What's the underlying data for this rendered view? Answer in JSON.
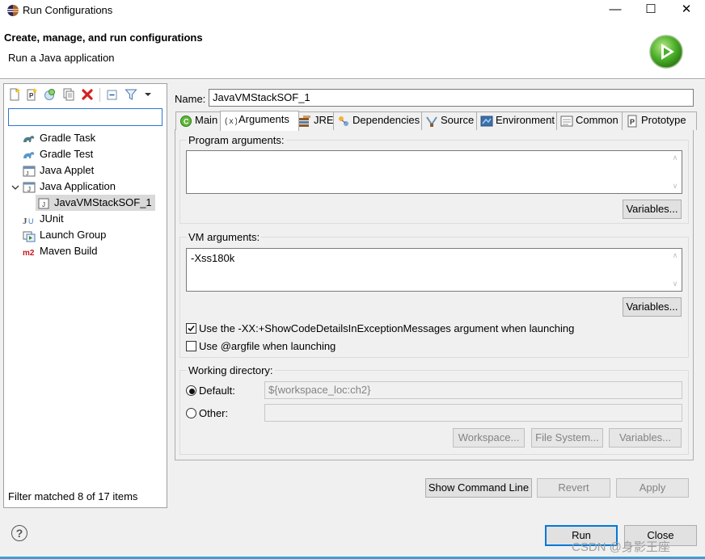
{
  "window": {
    "title": "Run Configurations",
    "minimize_glyph": "—",
    "maximize_glyph": "☐",
    "close_glyph": "✕"
  },
  "header": {
    "title": "Create, manage, and run configurations",
    "subtitle": "Run a Java application"
  },
  "left": {
    "toolbar_icons": [
      "new-configuration-icon",
      "new-prototype-icon",
      "export-icon",
      "duplicate-icon",
      "delete-icon",
      "collapse-all-icon",
      "filter-icon",
      "view-menu-icon"
    ],
    "filter_value": "",
    "tree": [
      {
        "label": "Gradle Task",
        "icon": "gradle-icon",
        "level": 0
      },
      {
        "label": "Gradle Test",
        "icon": "gradle-icon",
        "level": 0
      },
      {
        "label": "Java Applet",
        "icon": "java-applet-icon",
        "level": 0
      },
      {
        "label": "Java Application",
        "icon": "java-application-icon",
        "level": 0,
        "expanded": true
      },
      {
        "label": "JavaVMStackSOF_1",
        "icon": "java-launch-icon",
        "level": 1,
        "selected": true
      },
      {
        "label": "JUnit",
        "icon": "junit-icon",
        "level": 0
      },
      {
        "label": "Launch Group",
        "icon": "launch-group-icon",
        "level": 0
      },
      {
        "label": "Maven Build",
        "icon": "maven-icon",
        "level": 0
      }
    ],
    "status": "Filter matched 8 of 17 items"
  },
  "config": {
    "name_label": "Name:",
    "name_value": "JavaVMStackSOF_1",
    "tabs": [
      {
        "label": "Main",
        "icon": "main-tab-icon"
      },
      {
        "label": "Arguments",
        "icon": "arguments-tab-icon",
        "active": true
      },
      {
        "label": "JRE",
        "icon": "jre-tab-icon"
      },
      {
        "label": "Dependencies",
        "icon": "dependencies-tab-icon"
      },
      {
        "label": "Source",
        "icon": "source-tab-icon"
      },
      {
        "label": "Environment",
        "icon": "environment-tab-icon"
      },
      {
        "label": "Common",
        "icon": "common-tab-icon"
      },
      {
        "label": "Prototype",
        "icon": "prototype-tab-icon"
      }
    ],
    "program_args": {
      "label": "Program arguments:",
      "value": "",
      "variables_label": "Variables..."
    },
    "vm_args": {
      "label": "VM arguments:",
      "value": "-Xss180k",
      "variables_label": "Variables..."
    },
    "checkbox_showcode": {
      "label": "Use the -XX:+ShowCodeDetailsInExceptionMessages argument when launching",
      "checked": true
    },
    "checkbox_argfile": {
      "label": "Use @argfile when launching",
      "checked": false
    },
    "working_dir": {
      "label": "Working directory:",
      "default_label": "Default:",
      "default_value": "${workspace_loc:ch2}",
      "other_label": "Other:",
      "other_value": "",
      "workspace_label": "Workspace...",
      "filesystem_label": "File System...",
      "variables_label": "Variables..."
    },
    "show_command_line_label": "Show Command Line",
    "revert_label": "Revert",
    "apply_label": "Apply"
  },
  "footer": {
    "help_glyph": "?",
    "run_label": "Run",
    "close_label": "Close",
    "watermark": "CSDN @身影王座"
  }
}
